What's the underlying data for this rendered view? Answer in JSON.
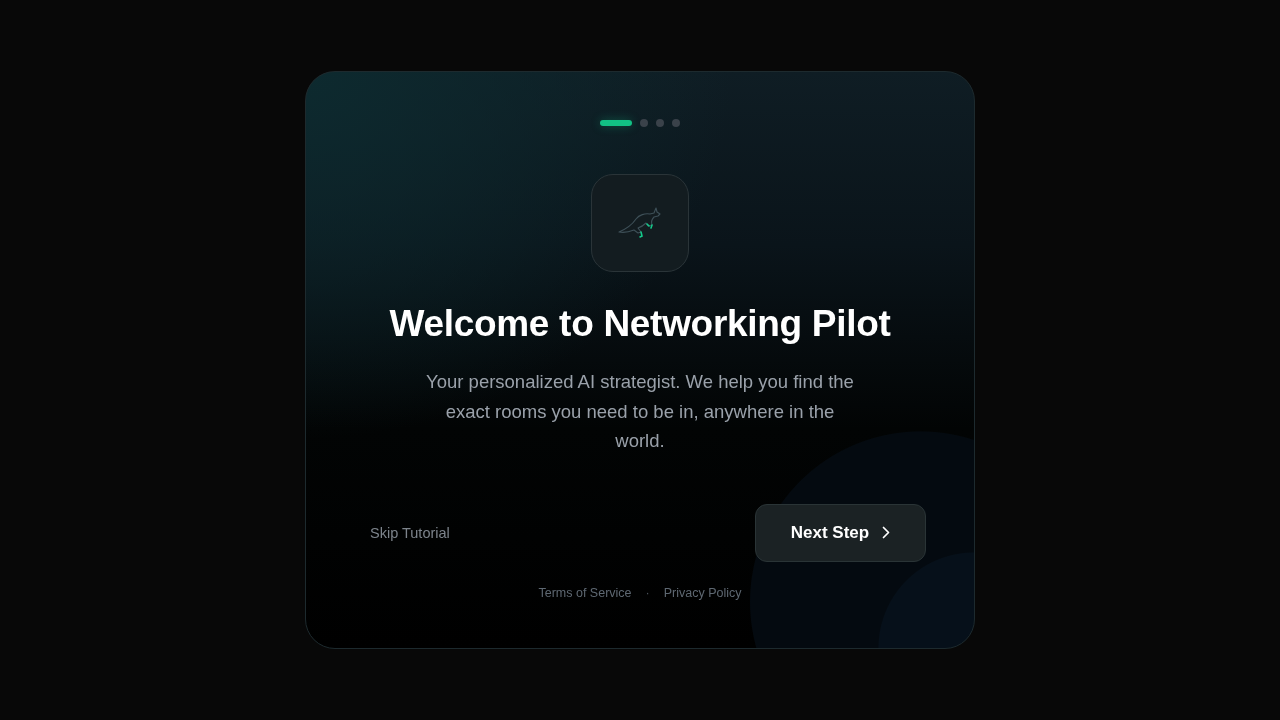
{
  "progress_steps": [
    {
      "selected": true
    },
    {
      "selected": false
    },
    {
      "selected": false
    },
    {
      "selected": false
    }
  ],
  "title": "Welcome to Networking Pilot",
  "description": "Your personalized AI strategist. We help you find the exact rooms you need to be in, anywhere in the world.",
  "actions": {
    "skip": "Skip Tutorial",
    "next": "Next Step"
  },
  "footer": {
    "links": [
      "Terms of Service",
      "Privacy Policy"
    ],
    "separator": "·"
  }
}
